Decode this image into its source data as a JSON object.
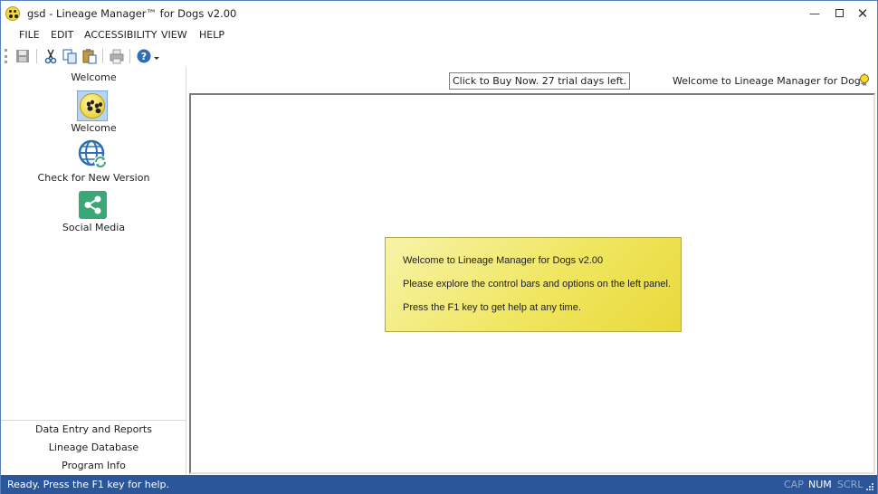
{
  "window": {
    "title": "gsd - Lineage Manager™ for Dogs v2.00",
    "icon": "paw-icon"
  },
  "menu": {
    "items": [
      "FILE",
      "EDIT",
      "ACCESSIBILITY",
      "VIEW",
      "HELP"
    ]
  },
  "toolbar": {
    "icons": [
      "save-icon",
      "cut-icon",
      "copy-icon",
      "paste-icon",
      "print-icon",
      "help-icon"
    ]
  },
  "left_panel": {
    "header": "Welcome",
    "items": [
      {
        "label": "Welcome",
        "icon": "paw-icon",
        "selected": true
      },
      {
        "label": "Check for New Version",
        "icon": "globe-refresh-icon"
      },
      {
        "label": "Social Media",
        "icon": "share-icon"
      }
    ],
    "bottom_links": [
      "Data Entry and Reports",
      "Lineage Database",
      "Program Info"
    ]
  },
  "content": {
    "buy_banner": "Click to Buy Now. 27 trial days left.",
    "header": "Welcome to Lineage Manager for Dogs",
    "note": {
      "line1": "Welcome to Lineage Manager for Dogs v2.00",
      "line2": "Please explore the control bars and options on the left panel.",
      "line3": "Press the F1 key to get help at any time."
    }
  },
  "status": {
    "text": "Ready.  Press the F1 key for help.",
    "cap": "CAP",
    "num": "NUM",
    "scrl": "SCRL"
  },
  "colors": {
    "status_bar": "#2b579a",
    "note_background": "#f0e660",
    "social_icon": "#3aa876",
    "globe_icon": "#2d6fb5"
  }
}
